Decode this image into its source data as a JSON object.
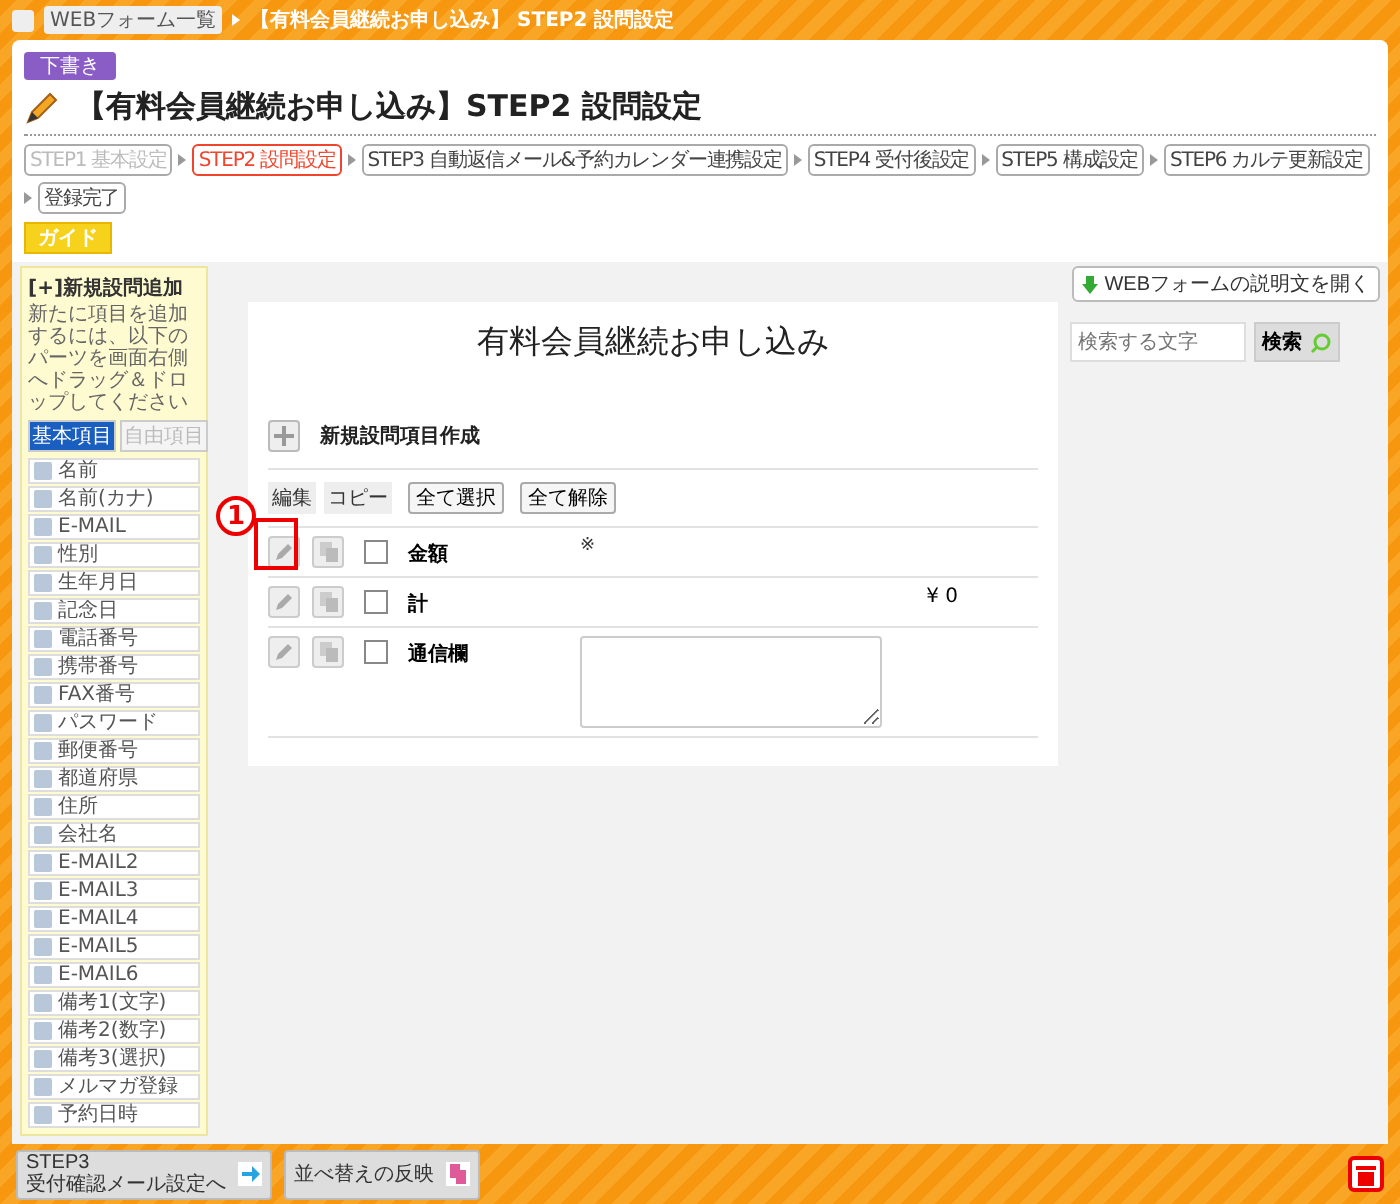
{
  "breadcrumb": {
    "items": [
      "WEBフォーム一覧",
      "【有料会員継続お申し込み】 STEP2 設問設定"
    ]
  },
  "status_badge": "下書き",
  "page_title": "【有料会員継続お申し込み】STEP2 設問設定",
  "steps": [
    {
      "label": "STEP1 基本設定",
      "done": true,
      "selected": false
    },
    {
      "label": "STEP2 設問設定",
      "done": false,
      "selected": true
    },
    {
      "label": "STEP3 自動返信メール&予約カレンダー連携設定",
      "done": false,
      "selected": false
    },
    {
      "label": "STEP4 受付後設定",
      "done": false,
      "selected": false
    },
    {
      "label": "STEP5 構成設定",
      "done": false,
      "selected": false
    },
    {
      "label": "STEP6 カルテ更新設定",
      "done": false,
      "selected": false
    },
    {
      "label": "登録完了",
      "done": false,
      "selected": false
    }
  ],
  "guide_button": "ガイド",
  "sidebar": {
    "heading": "[+]新規設問追加",
    "description": "新たに項目を追加するには、以下のパーツを画面右側へドラッグ＆ドロップしてください",
    "tabs": [
      {
        "label": "基本項目",
        "selected": true
      },
      {
        "label": "自由項目",
        "selected": false
      }
    ],
    "items": [
      "名前",
      "名前(カナ)",
      "E-MAIL",
      "性別",
      "生年月日",
      "記念日",
      "電話番号",
      "携帯番号",
      "FAX番号",
      "パスワード",
      "郵便番号",
      "都道府県",
      "住所",
      "会社名",
      "E-MAIL2",
      "E-MAIL3",
      "E-MAIL4",
      "E-MAIL5",
      "E-MAIL6",
      "備考1(文字)",
      "備考2(数字)",
      "備考3(選択)",
      "メルマガ登録",
      "予約日時"
    ]
  },
  "description_button": "WEBフォームの説明文を開く",
  "form": {
    "title": "有料会員継続お申し込み",
    "search": {
      "placeholder": "検索する文字",
      "button": "検索"
    },
    "new_item": "新規設問項目作成",
    "headers": [
      "編集",
      "コピー"
    ],
    "select_all": "全て選択",
    "deselect_all": "全て解除",
    "rows": [
      {
        "label": "金額",
        "checked": false,
        "kind": "note",
        "value": "※"
      },
      {
        "label": "計",
        "checked": false,
        "kind": "amount",
        "value": "¥ 0"
      },
      {
        "label": "通信欄",
        "checked": false,
        "kind": "textarea"
      }
    ]
  },
  "annotation": {
    "number": "1"
  },
  "footer": {
    "next_step": {
      "step": "STEP3",
      "label": "受付確認メール設定へ"
    },
    "apply_order": "並べ替えの反映"
  }
}
